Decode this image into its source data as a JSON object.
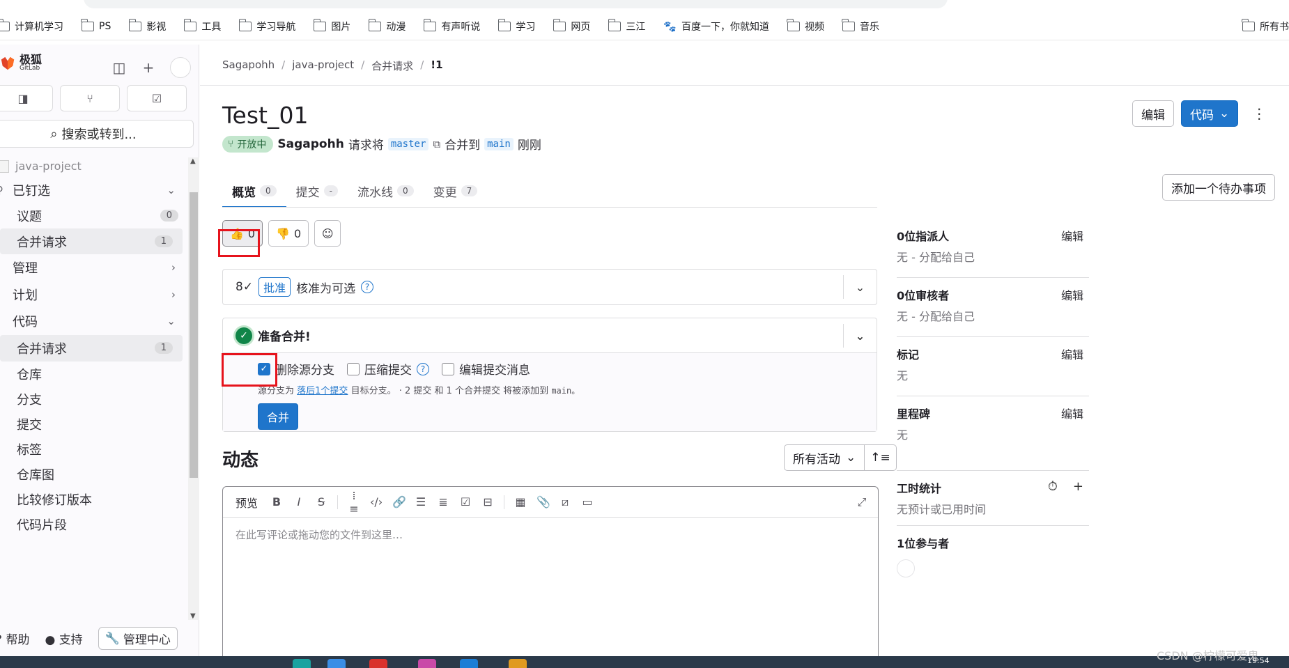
{
  "bookmarks": [
    "计算机学习",
    "PS",
    "影视",
    "工具",
    "学习导航",
    "图片",
    "动漫",
    "有声听说",
    "学习",
    "网页",
    "三江",
    "百度一下，你就知道",
    "视频",
    "音乐"
  ],
  "bookmarks_right": "所有书",
  "sidebar": {
    "brand_name": "极狐",
    "brand_sub": "GitLab",
    "search_label": "搜索或转到...",
    "project": "java-project",
    "items": [
      {
        "label": "已钉选",
        "type": "top",
        "chev": "⌄"
      },
      {
        "label": "议题",
        "type": "sub",
        "count": "0"
      },
      {
        "label": "合并请求",
        "type": "sub",
        "count": "1",
        "active": true
      },
      {
        "label": "管理",
        "type": "top",
        "chev": "›"
      },
      {
        "label": "计划",
        "type": "top",
        "chev": "›"
      },
      {
        "label": "代码",
        "type": "top",
        "chev": "⌄"
      },
      {
        "label": "合并请求",
        "type": "sub",
        "count": "1",
        "active": true
      },
      {
        "label": "仓库",
        "type": "sub"
      },
      {
        "label": "分支",
        "type": "sub"
      },
      {
        "label": "提交",
        "type": "sub"
      },
      {
        "label": "标签",
        "type": "sub"
      },
      {
        "label": "仓库图",
        "type": "sub"
      },
      {
        "label": "比较修订版本",
        "type": "sub"
      },
      {
        "label": "代码片段",
        "type": "sub"
      }
    ],
    "help": "帮助",
    "support": "支持",
    "admin": "管理中心"
  },
  "breadcrumb": [
    "Sagapohh",
    "java-project",
    "合并请求",
    "!1"
  ],
  "title": "Test_01",
  "header": {
    "edit": "编辑",
    "code": "代码"
  },
  "meta": {
    "status": "开放中",
    "author": "Sagapohh",
    "request_text": "请求将",
    "source_branch": "master",
    "merge_into": "合并到",
    "target_branch": "main",
    "time": "刚刚"
  },
  "tabs": [
    {
      "label": "概览",
      "count": "0",
      "active": true
    },
    {
      "label": "提交",
      "count": "-"
    },
    {
      "label": "流水线",
      "count": "0"
    },
    {
      "label": "变更",
      "count": "7"
    }
  ],
  "todo_button": "添加一个待办事项",
  "reactions": {
    "thumbs_up": "0",
    "thumbs_down": "0"
  },
  "approval": {
    "button": "批准",
    "text": "核准为可选"
  },
  "merge": {
    "title": "准备合并!",
    "options": [
      {
        "label": "删除源分支",
        "checked": true
      },
      {
        "label": "压缩提交",
        "checked": false,
        "help": true
      },
      {
        "label": "编辑提交消息",
        "checked": false
      }
    ],
    "desc_prefix": "源分支为",
    "desc_link": "落后1个提交",
    "desc_mid": "目标分支。 · 2 提交 和 1 个合并提交 将被添加到",
    "desc_branch": "main。",
    "button": "合并"
  },
  "activity": {
    "title": "动态",
    "filter": "所有活动",
    "editor_preview": "预览",
    "placeholder": "在此写评论或拖动您的文件到这里…"
  },
  "right_sidebar": [
    {
      "title": "0位指派人",
      "value": "无 - 分配给自己",
      "edit": "编辑"
    },
    {
      "title": "0位审核者",
      "value": "无 - 分配给自己",
      "edit": "编辑"
    },
    {
      "title": "标记",
      "value": "无",
      "edit": "编辑"
    },
    {
      "title": "里程碑",
      "value": "无",
      "edit": "编辑"
    },
    {
      "title": "工时统计",
      "value": "无预计或已用时间",
      "icons": true
    },
    {
      "title": "1位参与者",
      "avatar": true
    }
  ],
  "watermark": "CSDN @柠檬可爱鬼",
  "clock": "19:54",
  "colors": {
    "accent": "#1f75cb",
    "highlight": "#e6131c",
    "success": "#108548"
  }
}
